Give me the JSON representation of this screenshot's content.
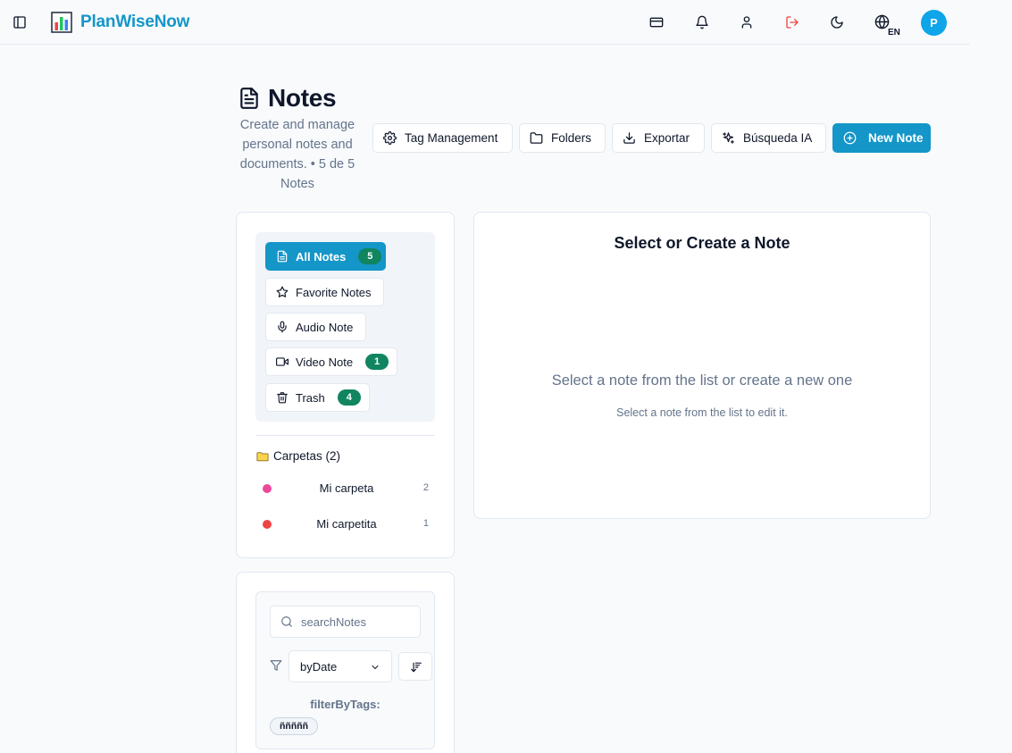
{
  "app": {
    "name": "PlanWiseNow",
    "language": "EN",
    "user_initial": "P",
    "brand_color": "#1496c8"
  },
  "topbar": {
    "icons": [
      "sidebar-toggle-icon",
      "credit-card-icon",
      "bell-icon",
      "user-icon",
      "logout-icon",
      "moon-icon",
      "globe-icon"
    ]
  },
  "page": {
    "title": "Notes",
    "description": "Create and manage personal notes and documents. • 5 de 5 Notes"
  },
  "toolbar": {
    "tag_management": "Tag Management",
    "folders": "Folders",
    "export": "Exportar",
    "ai_search": "Búsqueda IA",
    "new_note": "New Note"
  },
  "nav": {
    "items": [
      {
        "label": "All Notes",
        "count": "5",
        "icon": "file-text-icon",
        "active": true
      },
      {
        "label": "Favorite Notes",
        "count": null,
        "icon": "star-icon",
        "active": false
      },
      {
        "label": "Audio Note",
        "count": null,
        "icon": "mic-icon",
        "active": false
      },
      {
        "label": "Video Note",
        "count": "1",
        "icon": "video-icon",
        "active": false
      },
      {
        "label": "Trash",
        "count": "4",
        "icon": "trash-icon",
        "active": false
      }
    ]
  },
  "folders": {
    "heading": "Carpetas (2)",
    "items": [
      {
        "name": "Mi carpeta",
        "count": "2",
        "color": "#ec4899"
      },
      {
        "name": "Mi carpetita",
        "count": "1",
        "color": "#ef4444"
      }
    ]
  },
  "main": {
    "title": "Select or Create a Note",
    "message": "Select a note from the list or create a new one",
    "sub": "Select a note from the list to edit it."
  },
  "filters": {
    "search_placeholder": "searchNotes",
    "sort_value": "byDate",
    "tags_label": "filterByTags:",
    "tags": [
      "ñññññ"
    ]
  }
}
